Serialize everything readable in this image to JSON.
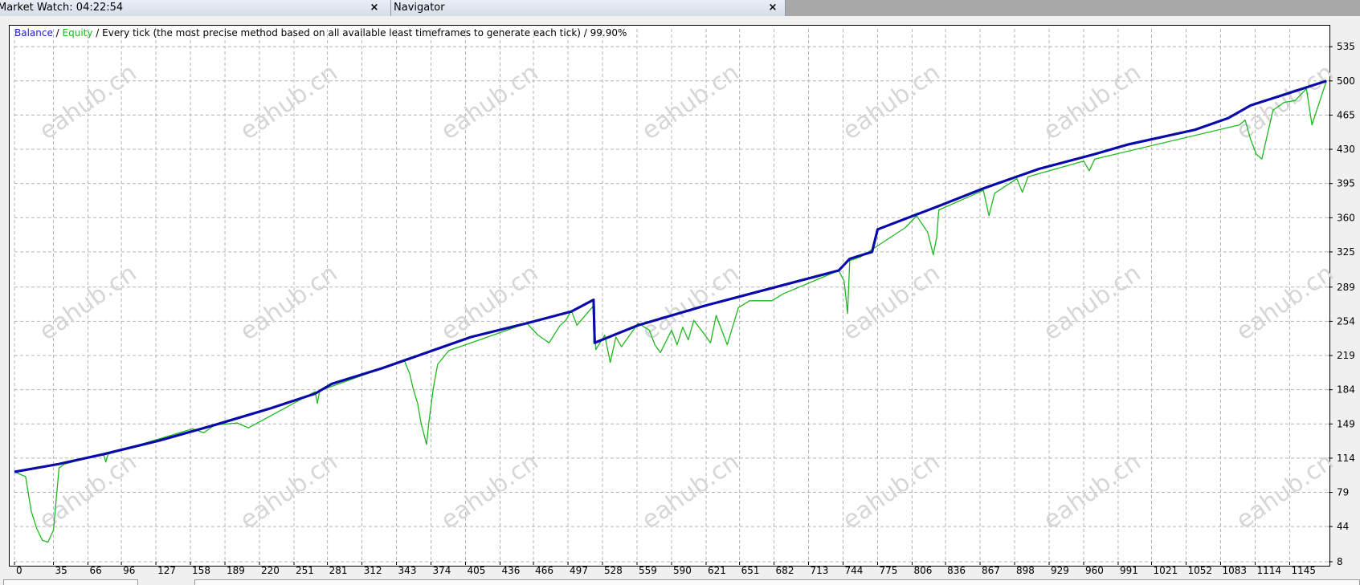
{
  "panels": {
    "market_watch": {
      "title": "Market Watch: 04:22:54",
      "close": "×"
    },
    "navigator": {
      "title": "Navigator",
      "close": "×"
    }
  },
  "watermark": "eahub.cn",
  "colors": {
    "balance": "#0a0aa8",
    "equity": "#1fb81f",
    "grid": "#b4b4b4",
    "axis_text": "#000000"
  },
  "chart_data": {
    "type": "line",
    "legend": {
      "balance": "Balance",
      "equity": "Equity",
      "sep1": " / ",
      "sep2": " / ",
      "description": "Every tick (the most precise method based on all available least timeframes to generate each tick)",
      "sep3": " / ",
      "quality": "99.90%"
    },
    "x_ticks": [
      0,
      35,
      66,
      96,
      127,
      158,
      189,
      220,
      251,
      281,
      312,
      343,
      374,
      405,
      436,
      466,
      497,
      528,
      559,
      590,
      621,
      651,
      682,
      713,
      744,
      775,
      806,
      836,
      867,
      898,
      929,
      960,
      991,
      1021,
      1052,
      1083,
      1114,
      1145
    ],
    "y_ticks": [
      8,
      44,
      79,
      114,
      149,
      184,
      219,
      254,
      289,
      325,
      360,
      395,
      430,
      465,
      500,
      535
    ],
    "xlim": [
      0,
      1180
    ],
    "ylim": [
      8,
      545
    ],
    "grid": true,
    "series": [
      {
        "name": "Balance",
        "x": [
          0,
          40,
          80,
          130,
          180,
          230,
          270,
          285,
          330,
          370,
          410,
          460,
          500,
          520,
          521,
          560,
          620,
          680,
          740,
          750,
          770,
          775,
          830,
          870,
          920,
          970,
          1000,
          1060,
          1090,
          1110,
          1140,
          1178
        ],
        "values": [
          100,
          108,
          118,
          132,
          148,
          165,
          180,
          190,
          206,
          222,
          238,
          252,
          264,
          276,
          232,
          250,
          270,
          288,
          306,
          318,
          325,
          348,
          372,
          390,
          410,
          425,
          435,
          450,
          462,
          475,
          486,
          500
        ]
      },
      {
        "name": "Equity",
        "x": [
          0,
          10,
          15,
          20,
          25,
          30,
          35,
          40,
          45,
          80,
          82,
          84,
          160,
          170,
          180,
          200,
          210,
          270,
          272,
          274,
          350,
          355,
          358,
          362,
          365,
          370,
          372,
          376,
          380,
          390,
          460,
          470,
          480,
          490,
          495,
          500,
          505,
          520,
          522,
          530,
          535,
          540,
          545,
          560,
          570,
          575,
          580,
          590,
          595,
          600,
          605,
          610,
          620,
          625,
          630,
          640,
          650,
          660,
          680,
          690,
          740,
          745,
          748,
          750,
          760,
          800,
          810,
          820,
          825,
          828,
          830,
          870,
          875,
          880,
          900,
          905,
          910,
          960,
          965,
          970,
          1100,
          1105,
          1110,
          1115,
          1120,
          1125,
          1130,
          1140,
          1150,
          1160,
          1165,
          1178
        ],
        "values": [
          100,
          95,
          60,
          42,
          30,
          28,
          40,
          104,
          108,
          118,
          110,
          118,
          144,
          140,
          148,
          150,
          145,
          182,
          170,
          183,
          214,
          200,
          185,
          170,
          150,
          128,
          150,
          185,
          210,
          224,
          252,
          240,
          232,
          250,
          255,
          265,
          250,
          270,
          225,
          240,
          212,
          238,
          228,
          252,
          245,
          230,
          222,
          245,
          230,
          248,
          235,
          255,
          240,
          232,
          260,
          230,
          268,
          275,
          275,
          282,
          306,
          295,
          262,
          316,
          320,
          350,
          362,
          345,
          322,
          340,
          368,
          388,
          362,
          385,
          400,
          386,
          402,
          418,
          408,
          420,
          455,
          460,
          440,
          425,
          420,
          445,
          470,
          478,
          480,
          492,
          455,
          500
        ]
      }
    ]
  }
}
